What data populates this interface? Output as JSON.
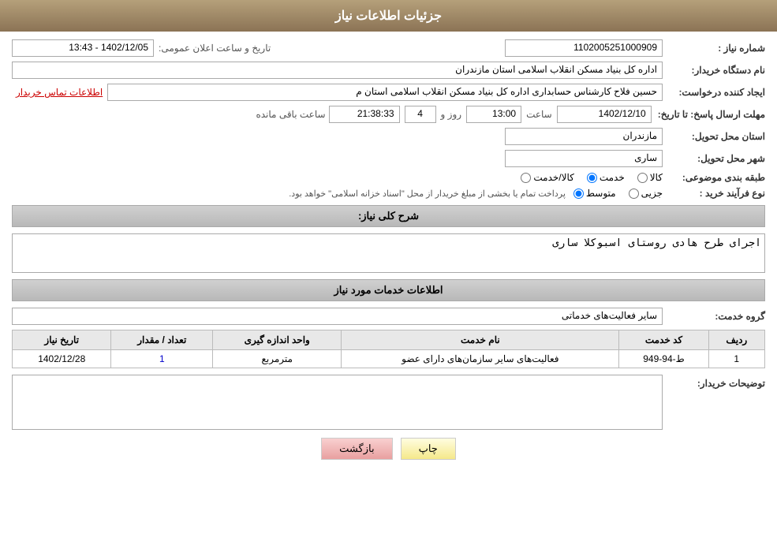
{
  "header": {
    "title": "جزئیات اطلاعات نیاز"
  },
  "fields": {
    "need_number_label": "شماره نیاز :",
    "need_number_value": "1102005251000909",
    "announce_date_label": "تاریخ و ساعت اعلان عمومی:",
    "announce_date_value": "1402/12/05 - 13:43",
    "buyer_org_label": "نام دستگاه خریدار:",
    "buyer_org_value": "اداره کل بنیاد مسکن انقلاب اسلامی استان مازندران",
    "creator_label": "ایجاد کننده درخواست:",
    "creator_name": "حسین فلاح کارشناس حسابداری اداره کل بنیاد مسکن انقلاب اسلامی استان م",
    "creator_contact": "اطلاعات تماس خریدار",
    "deadline_label": "مهلت ارسال پاسخ: تا تاریخ:",
    "deadline_date": "1402/12/10",
    "deadline_time_label": "ساعت",
    "deadline_time": "13:00",
    "deadline_day_label": "روز و",
    "deadline_days": "4",
    "deadline_remaining_label": "ساعت باقی مانده",
    "deadline_remaining": "21:38:33",
    "province_label": "استان محل تحویل:",
    "province_value": "مازندران",
    "city_label": "شهر محل تحویل:",
    "city_value": "ساری",
    "category_label": "طبقه بندی موضوعی:",
    "category_options": [
      "کالا",
      "خدمت",
      "کالا/خدمت"
    ],
    "category_selected": "خدمت",
    "process_label": "نوع فرآیند خرید :",
    "process_options": [
      "جزیی",
      "متوسط"
    ],
    "process_selected": "متوسط",
    "process_desc": "پرداخت تمام یا بخشی از مبلغ خریدار از محل \"اسناد خزانه اسلامی\" خواهد بود.",
    "description_label": "شرح کلی نیاز:",
    "description_value": "اجرای طرح هادی روستای اسبوکلا ساری",
    "services_section": "اطلاعات خدمات مورد نیاز",
    "service_group_label": "گروه خدمت:",
    "service_group_value": "سایر فعالیت‌های خدماتی",
    "table": {
      "headers": [
        "ردیف",
        "کد خدمت",
        "نام خدمت",
        "واحد اندازه گیری",
        "تعداد / مقدار",
        "تاریخ نیاز"
      ],
      "rows": [
        {
          "row_num": "1",
          "service_code": "ط-94-949",
          "service_name": "فعالیت‌های سایر سازمان‌های دارای عضو",
          "unit": "مترمربع",
          "quantity": "1",
          "need_date": "1402/12/28"
        }
      ]
    },
    "buyer_notes_label": "توضیحات خریدار:",
    "buyer_notes_value": ""
  },
  "buttons": {
    "print": "چاپ",
    "back": "بازگشت"
  },
  "colors": {
    "header_bg": "#8b7355",
    "section_bg": "#c8c8c8",
    "link_color": "#cc0000"
  }
}
